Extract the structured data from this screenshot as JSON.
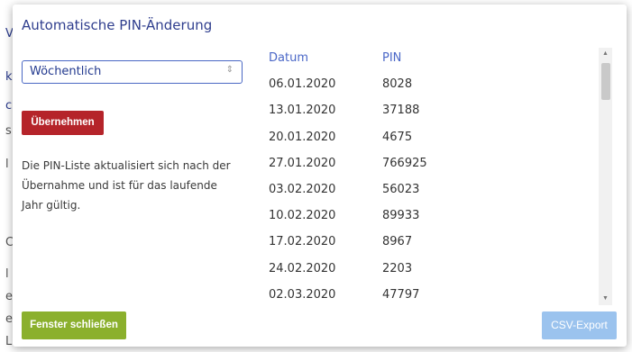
{
  "background_fragments": [
    "V",
    "k",
    "c",
    "s",
    "l",
    "C",
    "l",
    "e",
    "e",
    "L"
  ],
  "modal": {
    "title": "Automatische PIN-Änderung",
    "interval_select": {
      "value": "Wöchentlich"
    },
    "apply_label": "Übernehmen",
    "info_text": [
      "Die PIN-Liste aktualisiert sich nach der",
      "Übernahme und ist für das laufende",
      "Jahr gültig."
    ],
    "table": {
      "headers": {
        "date": "Datum",
        "pin": "PIN"
      },
      "rows": [
        {
          "date": "06.01.2020",
          "pin": "8028"
        },
        {
          "date": "13.01.2020",
          "pin": "37188"
        },
        {
          "date": "20.01.2020",
          "pin": "4675"
        },
        {
          "date": "27.01.2020",
          "pin": "766925"
        },
        {
          "date": "03.02.2020",
          "pin": "56023"
        },
        {
          "date": "10.02.2020",
          "pin": "89933"
        },
        {
          "date": "17.02.2020",
          "pin": "8967"
        },
        {
          "date": "24.02.2020",
          "pin": "2203"
        },
        {
          "date": "02.03.2020",
          "pin": "47797"
        }
      ]
    },
    "close_label": "Fenster schließen",
    "csv_label": "CSV-Export"
  },
  "colors": {
    "title": "#2f3e8e",
    "apply_button": "#b5242a",
    "close_button": "#8bb02d",
    "csv_button": "#9bc3ee",
    "table_header": "#4a67c7"
  }
}
